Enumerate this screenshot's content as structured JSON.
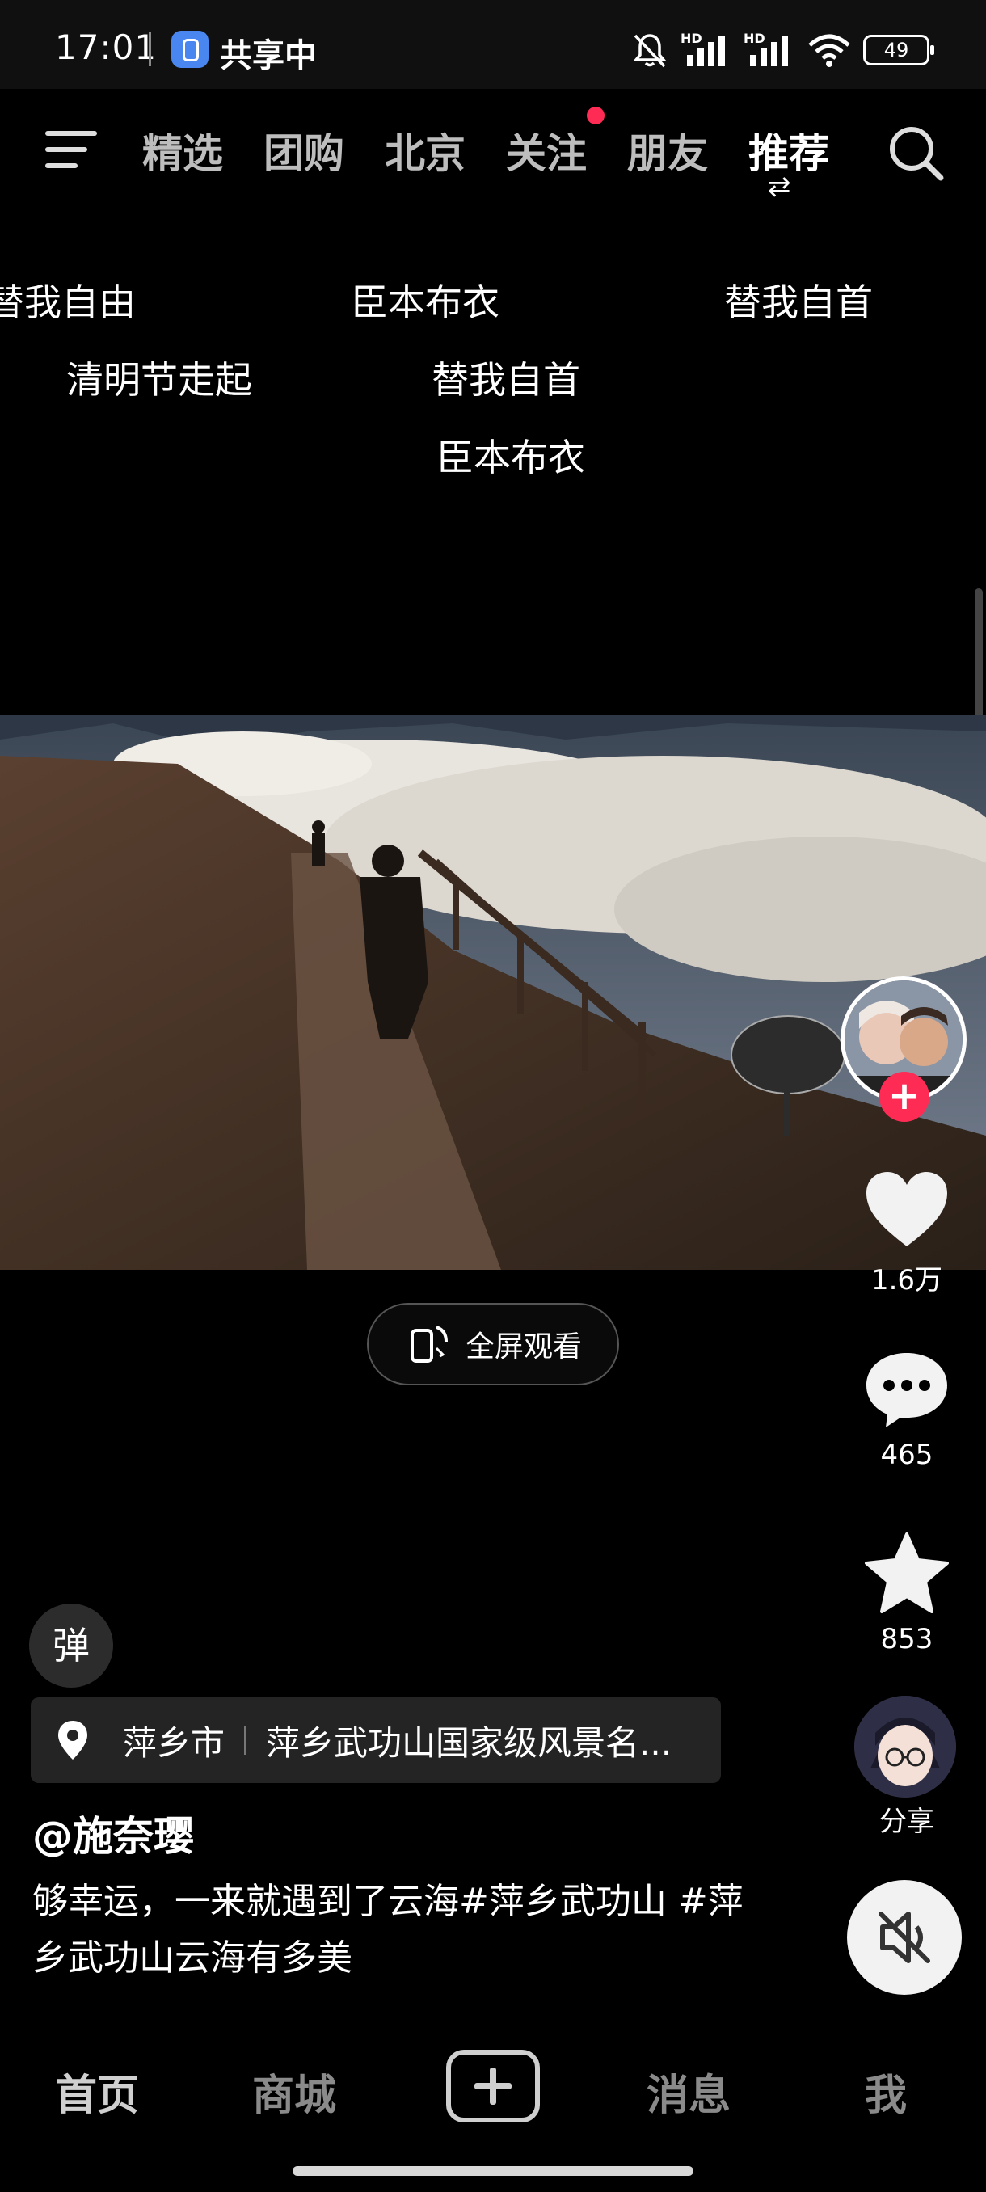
{
  "status_bar": {
    "time": "17:01",
    "share_status": "共享中",
    "network_1": "HD",
    "network_2": "HD",
    "battery": "49",
    "icons": [
      "mute-bell-icon",
      "signal-icon",
      "signal-icon",
      "wifi-icon",
      "battery-icon"
    ]
  },
  "top_nav": {
    "tabs": [
      {
        "label": "精选"
      },
      {
        "label": "团购"
      },
      {
        "label": "北京"
      },
      {
        "label": "关注",
        "has_dot": true
      },
      {
        "label": "朋友"
      },
      {
        "label": "推荐",
        "active": true
      }
    ],
    "icons": [
      "menu-icon",
      "swap-icon",
      "search-icon"
    ]
  },
  "danmaku": [
    "替我自由",
    "臣本布衣",
    "替我自首",
    "清明节走起",
    "替我自首",
    "臣本布衣"
  ],
  "player": {
    "fullscreen_label": "全屏观看"
  },
  "actions": {
    "likes": "1.6万",
    "comments": "465",
    "favorites": "853",
    "share_label": "分享",
    "follow_symbol": "+"
  },
  "post": {
    "danmu_toggle": "弹",
    "location_city": "萍乡市",
    "location_place": "萍乡武功山国家级风景名...",
    "username": "@施奈璎",
    "caption": "够幸运，一来就遇到了云海#萍乡武功山 #萍乡武功山云海有多美"
  },
  "bottom_nav": {
    "items": [
      "首页",
      "商城",
      "消息",
      "我"
    ]
  },
  "colors": {
    "accent": "#fe2c55",
    "background": "#000000"
  }
}
